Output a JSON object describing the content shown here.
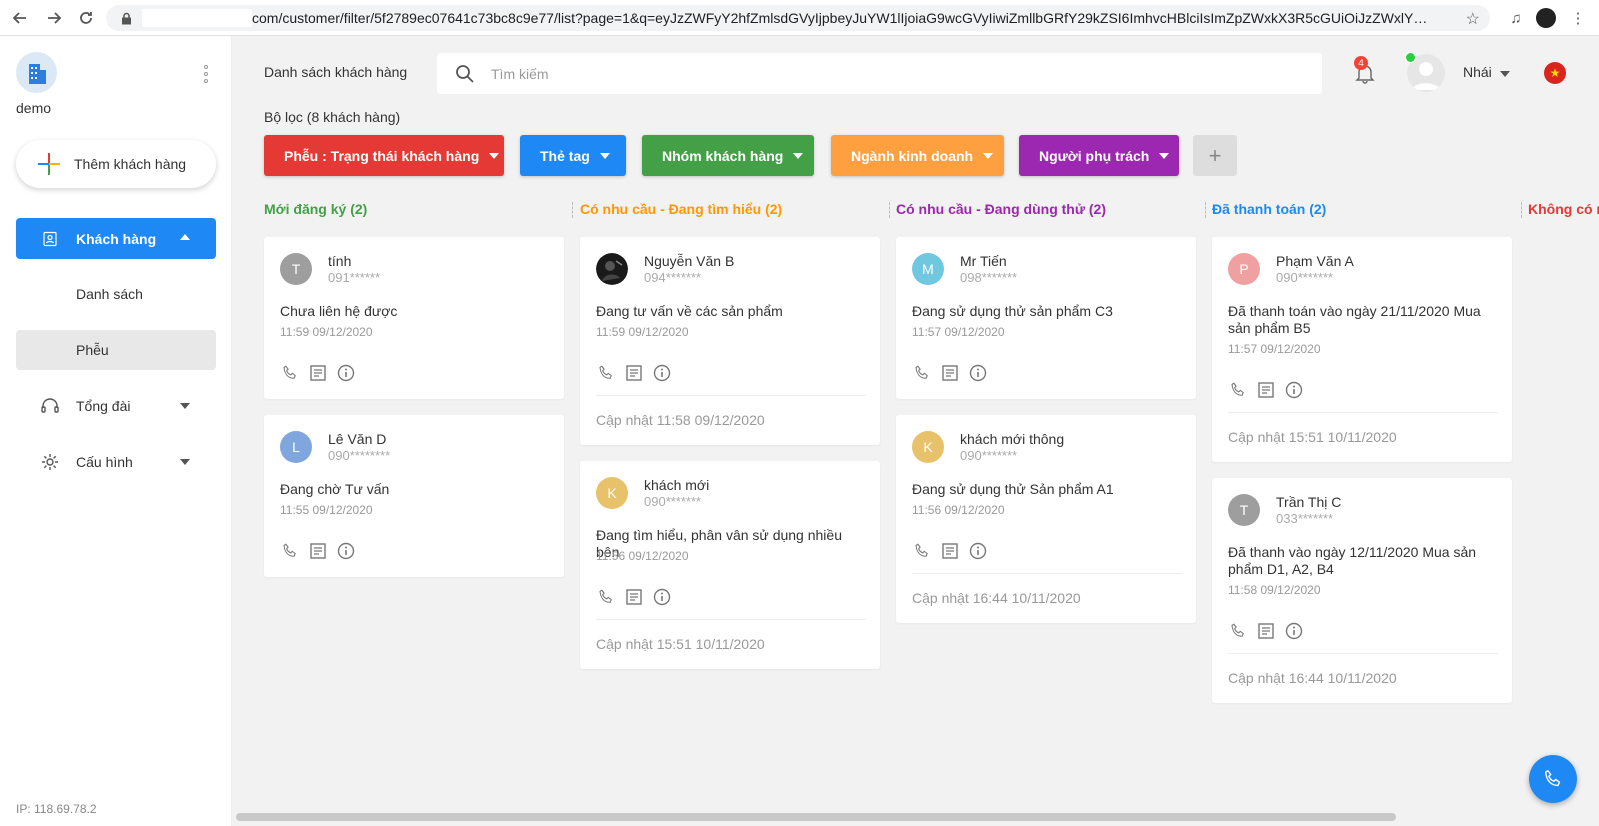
{
  "browser": {
    "url": "com/customer/filter/5f2789ec07641c73bc8c9e77/list?page=1&q=eyJzZWFyY2hfZmlsdGVyIjpbeyJuYW1lIjoiaG9wcGVyIiwiZmllbGRfY29kZSI6ImhvcHBlciIsImZpZWxkX3R5cGUiOiJzZWxlY3QiLCJpc1..."
  },
  "sidebar": {
    "org_name": "demo",
    "add_customer": "Thêm khách hàng",
    "menu_customers": "Khách hàng",
    "submenu_list": "Danh sách",
    "submenu_funnel": "Phễu",
    "menu_switchboard": "Tổng đài",
    "menu_config": "Cấu hình",
    "ip": "IP: 118.69.78.2"
  },
  "header": {
    "title": "Danh sách khách hàng",
    "search_placeholder": "Tìm kiếm",
    "notif_count": "4",
    "user_name": "Nhái",
    "flag_star": "★"
  },
  "filters": {
    "label": "Bộ lọc (8 khách hàng)",
    "buttons": [
      {
        "label": "Phễu : Trạng thái khách hàng",
        "color": "#e53935"
      },
      {
        "label": "Thẻ tag",
        "color": "#1e88f5"
      },
      {
        "label": "Nhóm khách hàng",
        "color": "#43a047"
      },
      {
        "label": "Ngành kinh doanh",
        "color": "#ffa040"
      },
      {
        "label": "Người phụ trách",
        "color": "#9c27b0"
      }
    ],
    "add": "+"
  },
  "columns": [
    {
      "title": "Mới đăng ký (2)",
      "color": "#43a047"
    },
    {
      "title": "Có nhu cầu - Đang tìm hiểu (2)",
      "color": "#ff9800"
    },
    {
      "title": "Có nhu cầu - Đang dùng thử (2)",
      "color": "#9c27b0"
    },
    {
      "title": "Đã thanh toán (2)",
      "color": "#1e88f5"
    },
    {
      "title": "Không có n",
      "color": "#e53935"
    }
  ],
  "cards": [
    {
      "initial": "T",
      "avatar_color": "#9e9e9e",
      "name": "tính",
      "phone": "091******",
      "note": "Chưa liên hệ được",
      "time": "11:59 09/12/2020",
      "updated": ""
    },
    {
      "initial": "L",
      "avatar_color": "#7fa7de",
      "name": "Lê Văn D",
      "phone": "090********",
      "note": "Đang chờ Tư vấn",
      "time": "11:55 09/12/2020",
      "updated": ""
    },
    {
      "initial": "",
      "avatar_color": "#222222",
      "name": "Nguyễn Văn B",
      "phone": "094*******",
      "note": "Đang tư vấn về các sản phẩm",
      "time": "11:59 09/12/2020",
      "updated": "Cập nhật 11:58 09/12/2020"
    },
    {
      "initial": "K",
      "avatar_color": "#e8c16b",
      "name": "khách mới",
      "phone": "090*******",
      "note": "Đang tìm hiểu, phân vân sử dụng nhiều bên",
      "time": "11:56 09/12/2020",
      "updated": "Cập nhật 15:51 10/11/2020"
    },
    {
      "initial": "M",
      "avatar_color": "#6fc8e0",
      "name": "Mr Tiến",
      "phone": "098*******",
      "note": "Đang sử dụng thử sản phẩm C3",
      "time": "11:57 09/12/2020",
      "updated": ""
    },
    {
      "initial": "K",
      "avatar_color": "#e8c16b",
      "name": "khách mới thông",
      "phone": "090*******",
      "note": "Đang sử dụng thử Sản phẩm A1",
      "time": "11:56 09/12/2020",
      "updated": "Cập nhật 16:44 10/11/2020"
    },
    {
      "initial": "P",
      "avatar_color": "#f0a0a0",
      "name": "Phạm Văn A",
      "phone": "090*******",
      "note": "Đã thanh toán vào ngày 21/11/2020 Mua sản phẩm B5",
      "time": "11:57 09/12/2020",
      "updated": "Cập nhật 15:51 10/11/2020"
    },
    {
      "initial": "T",
      "avatar_color": "#9e9e9e",
      "name": "Trần Thị C",
      "phone": "033*******",
      "note": "Đã thanh vào ngày 12/11/2020 Mua sản phẩm D1, A2, B4",
      "time": "11:58 09/12/2020",
      "updated": "Cập nhật 16:44 10/11/2020"
    }
  ]
}
